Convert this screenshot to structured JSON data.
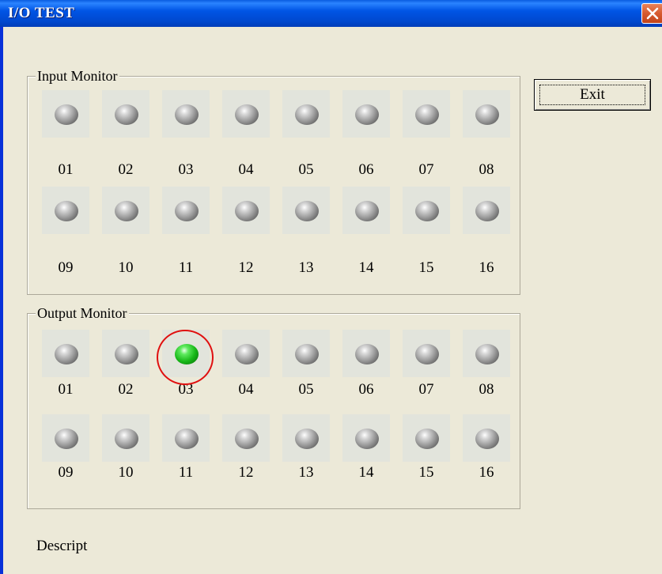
{
  "window": {
    "title": "I/O TEST"
  },
  "exit_button": {
    "label": "Exit"
  },
  "input_monitor": {
    "label": "Input Monitor",
    "channels": [
      "01",
      "02",
      "03",
      "04",
      "05",
      "06",
      "07",
      "08",
      "09",
      "10",
      "11",
      "12",
      "13",
      "14",
      "15",
      "16"
    ],
    "active": []
  },
  "output_monitor": {
    "label": "Output Monitor",
    "channels": [
      "01",
      "02",
      "03",
      "04",
      "05",
      "06",
      "07",
      "08",
      "09",
      "10",
      "11",
      "12",
      "13",
      "14",
      "15",
      "16"
    ],
    "active": [
      "03"
    ]
  },
  "description": {
    "label": "Descript"
  },
  "colors": {
    "title_bar": "#0055E5",
    "close_button": "#D65A2F",
    "led_off": "#9A9A9A",
    "led_on": "#18B818",
    "highlight_circle": "#E01010"
  }
}
